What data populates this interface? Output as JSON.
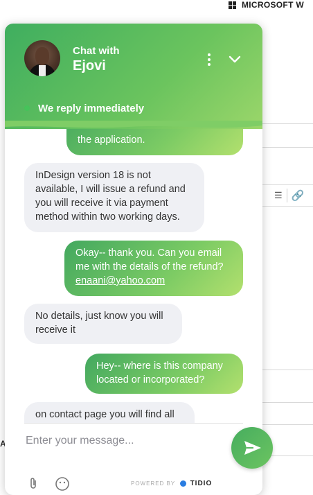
{
  "background": {
    "app_title": "MICROSOFT W",
    "toolbar": {
      "list_icon": "numbered-list-icon",
      "link_icon": "link-icon"
    },
    "stray_text": "A"
  },
  "chat": {
    "title_prefix": "Chat with",
    "agent_name": "Ejovi",
    "status": "We reply immediately",
    "messages": [
      {
        "from": "user",
        "text": "the application."
      },
      {
        "from": "agent",
        "text": "InDesign version 18 is not available, I will issue a refund and you will receive it via payment method within two working days."
      },
      {
        "from": "user",
        "text": "Okay-- thank you. Can you email me with the details of the refund?",
        "link": "enaani@yahoo.com"
      },
      {
        "from": "agent",
        "text": "No details, just know you will receive it"
      },
      {
        "from": "user",
        "text": "Hey-- where is this company located or incorporated?"
      },
      {
        "from": "agent",
        "text": "on contact page you will find all"
      }
    ],
    "input_placeholder": "Enter your message...",
    "powered_by": "POWERED BY",
    "brand": "TIDIO"
  },
  "colors": {
    "accent": "#4caf50",
    "accent_light": "#a6db6c",
    "incoming_bg": "#eff0f4"
  }
}
